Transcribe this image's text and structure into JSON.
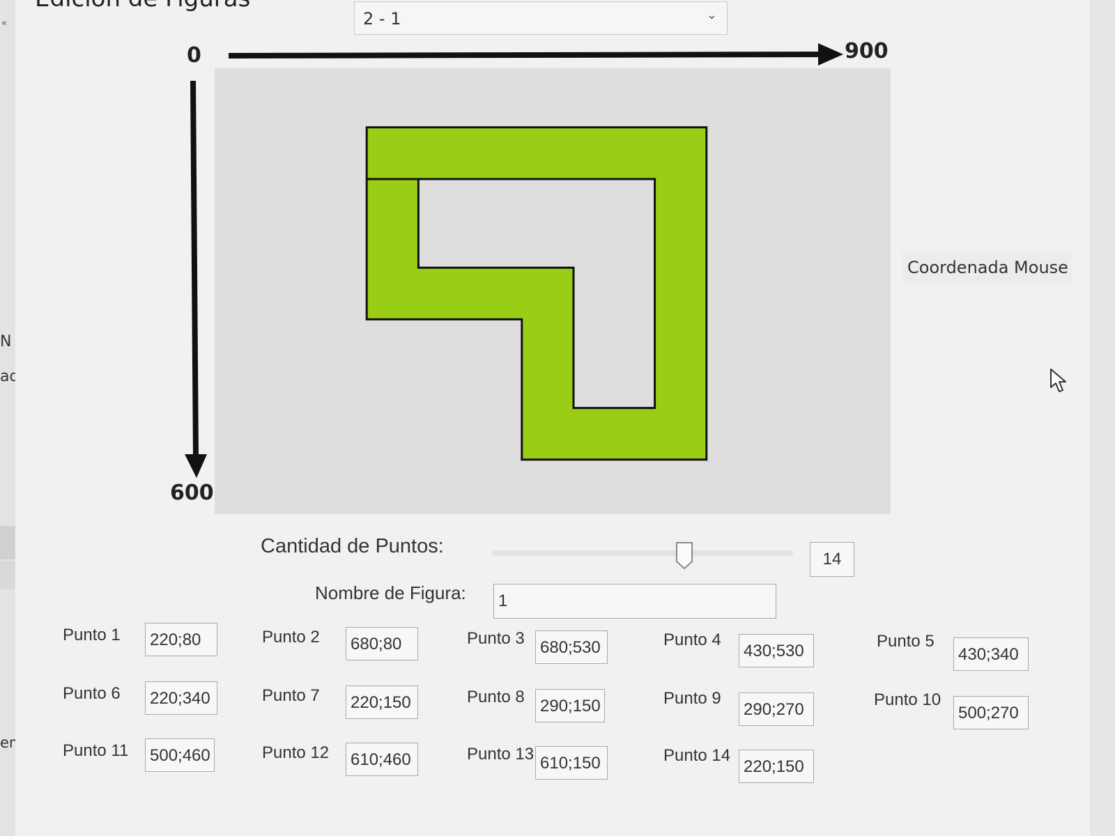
{
  "window": {
    "title": "Edición de Figuras"
  },
  "sidebar": {
    "collapse_glyph": "«",
    "frag1": "N",
    "frag2": "ad",
    "frag3": "eme"
  },
  "figure_select": {
    "value": "2 - 1",
    "chevron": "⌄"
  },
  "axes": {
    "x_min": "0",
    "x_max": "900",
    "y_max": "600"
  },
  "figure": {
    "fill": "#9acd16",
    "stroke": "#111111",
    "points": [
      [
        220,
        80
      ],
      [
        680,
        80
      ],
      [
        680,
        530
      ],
      [
        430,
        530
      ],
      [
        430,
        340
      ],
      [
        220,
        340
      ],
      [
        220,
        150
      ],
      [
        290,
        150
      ],
      [
        290,
        270
      ],
      [
        500,
        270
      ],
      [
        500,
        460
      ],
      [
        610,
        460
      ],
      [
        610,
        150
      ],
      [
        220,
        150
      ]
    ]
  },
  "mouse_button": {
    "label": "Coordenada Mouse"
  },
  "count": {
    "label": "Cantidad de Puntos:",
    "value": "14",
    "slider_fraction": 0.64
  },
  "name": {
    "label": "Nombre de Figura:",
    "value": "1"
  },
  "points_list": [
    {
      "label": "Punto 1",
      "value": "220;80"
    },
    {
      "label": "Punto 2",
      "value": "680;80"
    },
    {
      "label": "Punto 3",
      "value": "680;530"
    },
    {
      "label": "Punto 4",
      "value": "430;530"
    },
    {
      "label": "Punto 5",
      "value": "430;340"
    },
    {
      "label": "Punto 6",
      "value": "220;340"
    },
    {
      "label": "Punto 7",
      "value": "220;150"
    },
    {
      "label": "Punto 8",
      "value": "290;150"
    },
    {
      "label": "Punto 9",
      "value": "290;270"
    },
    {
      "label": "Punto 10",
      "value": "500;270"
    },
    {
      "label": "Punto 11",
      "value": "500;460"
    },
    {
      "label": "Punto 12",
      "value": "610;460"
    },
    {
      "label": "Punto 13",
      "value": "610;150"
    },
    {
      "label": "Punto 14",
      "value": "220;150"
    }
  ],
  "icons": {
    "cursor": "mouse-cursor-icon",
    "dropdown": "chevron-down-icon",
    "slider": "slider-thumb"
  }
}
